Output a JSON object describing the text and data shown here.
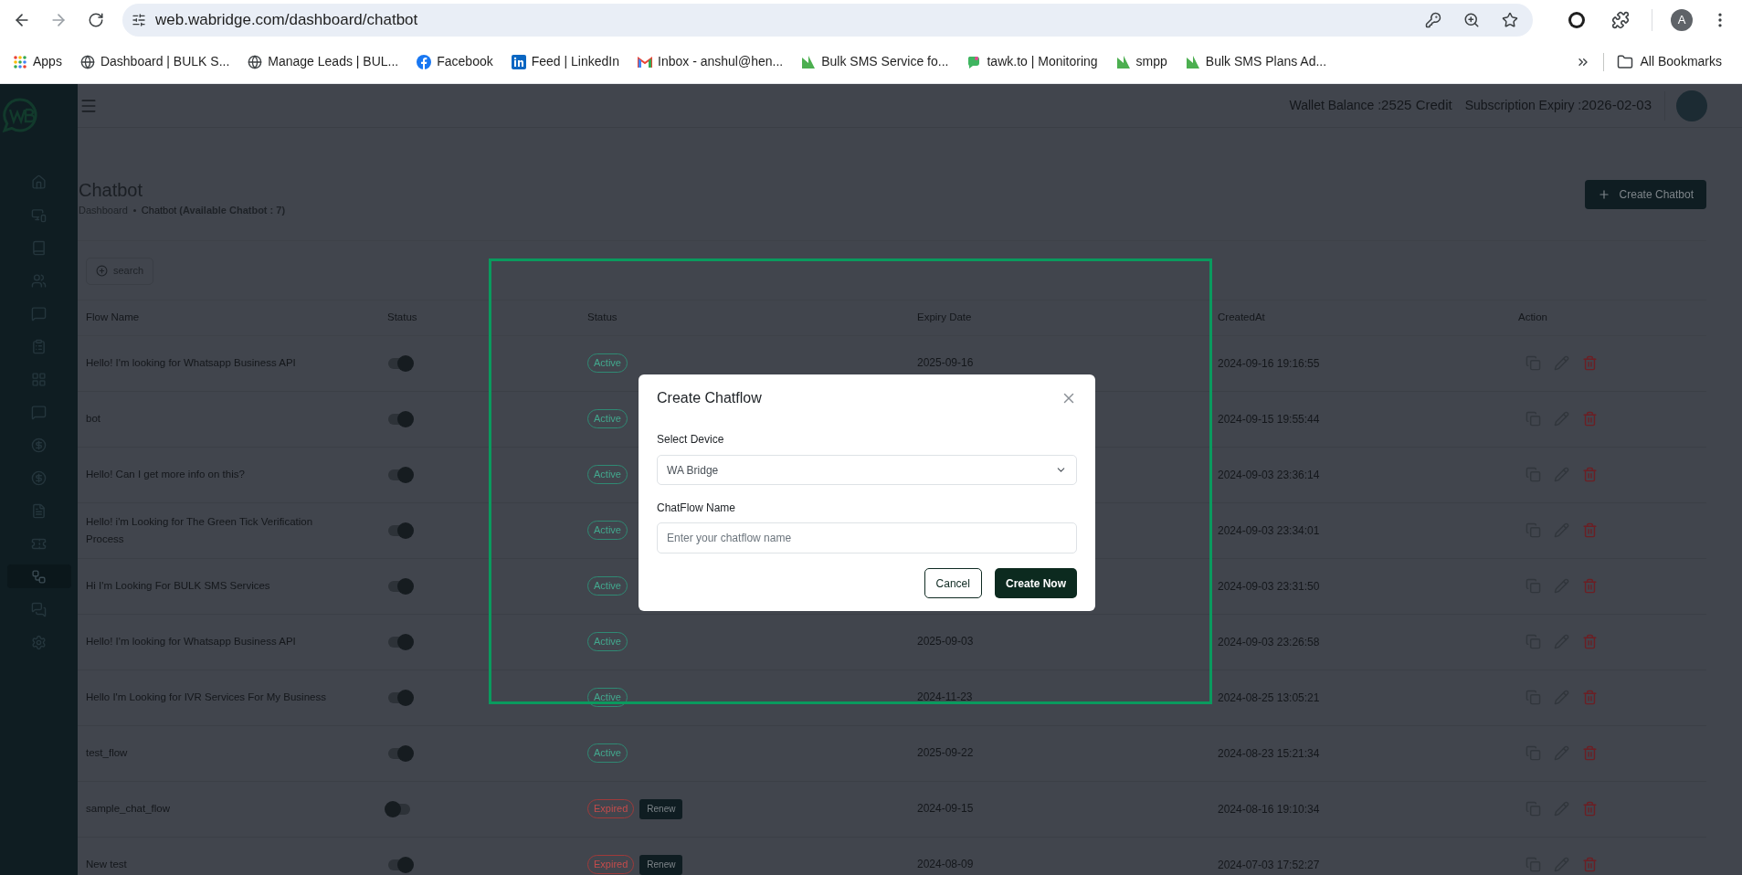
{
  "browser": {
    "url": "web.wabridge.com/dashboard/chatbot",
    "profile_initial": "A",
    "bookmarks": [
      {
        "kind": "apps",
        "label": "Apps"
      },
      {
        "kind": "globe",
        "label": "Dashboard | BULK S..."
      },
      {
        "kind": "globe",
        "label": "Manage Leads | BUL..."
      },
      {
        "kind": "facebook",
        "label": "Facebook"
      },
      {
        "kind": "linkedin",
        "label": "Feed | LinkedIn"
      },
      {
        "kind": "gmail",
        "label": "Inbox - anshul@hen..."
      },
      {
        "kind": "leaf",
        "label": "Bulk SMS Service fo..."
      },
      {
        "kind": "tawk",
        "label": "tawk.to | Monitoring"
      },
      {
        "kind": "leaf",
        "label": "smpp"
      },
      {
        "kind": "leaf",
        "label": "Bulk SMS Plans Ad..."
      }
    ],
    "all_bookmarks": "All Bookmarks"
  },
  "sidebar": {
    "items": [
      {
        "kind": "home",
        "selected": false
      },
      {
        "kind": "devices",
        "selected": false
      },
      {
        "kind": "book",
        "selected": false
      },
      {
        "kind": "users",
        "selected": false
      },
      {
        "kind": "message",
        "selected": false
      },
      {
        "kind": "clipboard",
        "selected": false
      },
      {
        "kind": "grid",
        "selected": false
      },
      {
        "kind": "message",
        "selected": false
      },
      {
        "kind": "dollar",
        "selected": false
      },
      {
        "kind": "dollar",
        "selected": false
      },
      {
        "kind": "pdf",
        "selected": false
      },
      {
        "kind": "ticket",
        "selected": false
      },
      {
        "kind": "flow",
        "selected": true
      },
      {
        "kind": "chat",
        "selected": false
      },
      {
        "kind": "settings",
        "selected": false
      }
    ]
  },
  "header": {
    "wallet_label": "Wallet Balance :",
    "wallet_value": "2525 Credit",
    "expiry_label": "Subscription Expiry :",
    "expiry_value": "2026-02-03"
  },
  "page": {
    "title": "Chatbot",
    "breadcrumb": [
      "Dashboard",
      "Chatbot"
    ],
    "available": "(Available Chatbot : 7)",
    "create_button": "Create Chatbot",
    "search_button": "search"
  },
  "table": {
    "columns": [
      "Flow Name",
      "Status",
      "Status",
      "Expiry Date",
      "CreatedAt",
      "Action"
    ],
    "rows": [
      {
        "name": "Hello! I'm looking for Whatsapp Business API",
        "enabled": true,
        "status": {
          "kind": "active",
          "label": "Active"
        },
        "expiry": "2025-09-16",
        "created": "2024-09-16 19:16:55"
      },
      {
        "name": "bot",
        "enabled": true,
        "status": {
          "kind": "active",
          "label": "Active"
        },
        "created": "2024-09-15 19:55:44"
      },
      {
        "name": "Hello! Can I get more info on this?",
        "enabled": true,
        "status": {
          "kind": "active",
          "label": "Active"
        },
        "created": "2024-09-03 23:36:14"
      },
      {
        "name": "Hello! i'm Looking for The Green Tick Verification Process",
        "enabled": true,
        "status": {
          "kind": "active",
          "label": "Active"
        },
        "created": "2024-09-03 23:34:01"
      },
      {
        "name": "Hi I'm Looking For BULK SMS Services",
        "enabled": true,
        "status": {
          "kind": "active",
          "label": "Active"
        },
        "created": "2024-09-03 23:31:50"
      },
      {
        "name": "Hello! I'm looking for Whatsapp Business API",
        "enabled": true,
        "status": {
          "kind": "active",
          "label": "Active"
        },
        "expiry": "2025-09-03",
        "created": "2024-09-03 23:26:58"
      },
      {
        "name": "Hello I'm Looking for IVR Services For My Business",
        "enabled": true,
        "status": {
          "kind": "active",
          "label": "Active"
        },
        "expiry": "2024-11-23",
        "created": "2024-08-25 13:05:21"
      },
      {
        "name": "test_flow",
        "enabled": true,
        "status": {
          "kind": "active",
          "label": "Active"
        },
        "expiry": "2025-09-22",
        "created": "2024-08-23 15:21:34"
      },
      {
        "name": "sample_chat_flow",
        "enabled": false,
        "status": {
          "kind": "expired",
          "label": "Expired"
        },
        "renew": "Renew",
        "expiry": "2024-09-15",
        "created": "2024-08-16 19:10:34"
      },
      {
        "name": "New test",
        "enabled": true,
        "status": {
          "kind": "expired",
          "label": "Expired"
        },
        "renew": "Renew",
        "expiry": "2024-08-09",
        "created": "2024-07-03 17:52:27"
      }
    ]
  },
  "modal": {
    "title": "Create Chatflow",
    "device_label": "Select Device",
    "device_value": "WA Bridge",
    "name_label": "ChatFlow Name",
    "name_placeholder": "Enter your chatflow name",
    "buttons": [
      {
        "kind": "secondary",
        "label": "Cancel"
      },
      {
        "kind": "primary",
        "label": "Create Now"
      }
    ]
  }
}
